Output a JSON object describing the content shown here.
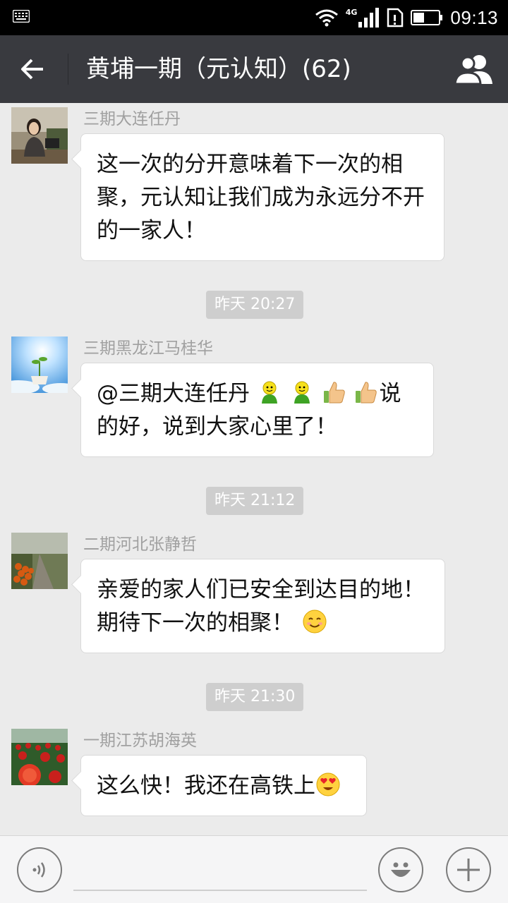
{
  "status_bar": {
    "network": "4G",
    "time": "09:13"
  },
  "header": {
    "title": "黄埔一期（元认知）(62)",
    "back_icon": "arrow-left-icon",
    "members_icon": "group-icon"
  },
  "messages": [
    {
      "sender": "三期大连任丹",
      "text": "这一次的分开意味着下一次的相聚，元认知让我们成为永远分不开的一家人！"
    },
    {
      "sender": "三期黑龙江马桂华",
      "text_before": "@三期大连任丹",
      "emojis": [
        "green-man-emoji",
        "green-man-emoji",
        "thumbs-up-emoji",
        "thumbs-up-emoji"
      ],
      "text_after": "说的好，说到大家心里了！"
    },
    {
      "sender": "二期河北张静哲",
      "text": "亲爱的家人们已安全到达目的地！期待下一次的相聚！",
      "emoji": "smile-emoji"
    },
    {
      "sender": "一期江苏胡海英",
      "text": "这么快！我还在高铁上",
      "emoji": "heart-eyes-emoji"
    }
  ],
  "timestamps": [
    "昨天 20:27",
    "昨天 21:12",
    "昨天 21:30"
  ],
  "input_bar": {
    "voice_icon": "voice-icon",
    "text_value": "",
    "emoji_icon": "smiley-icon",
    "more_icon": "plus-icon"
  },
  "colors": {
    "header_bg": "#393a3f",
    "chat_bg": "#ebebeb",
    "bubble_bg": "#ffffff",
    "timestamp_bg": "#cecece"
  }
}
